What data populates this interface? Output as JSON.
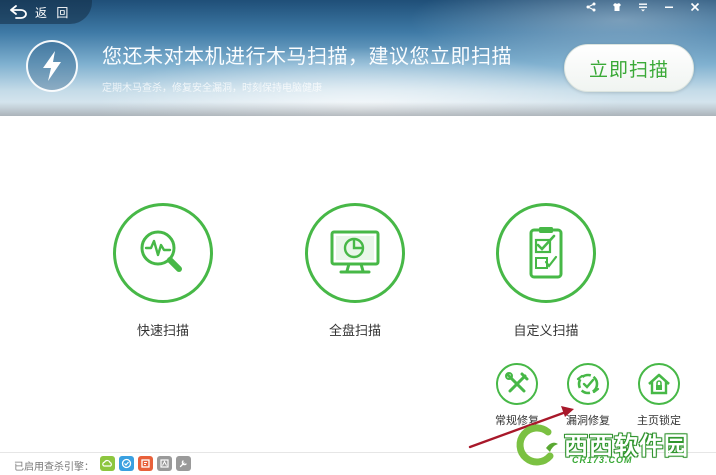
{
  "header": {
    "back_label": "返 回",
    "headline": "您还未对本机进行木马扫描，建议您立即扫描",
    "subline": "定期木马查杀，修复安全漏洞，时刻保持电脑健康",
    "scan_now_label": "立即扫描",
    "window_icons": [
      "share-icon",
      "skin-icon",
      "menu-icon",
      "minimize-icon",
      "close-icon"
    ]
  },
  "scan_options": [
    {
      "label": "快速扫描",
      "icon": "quick-scan-icon"
    },
    {
      "label": "全盘扫描",
      "icon": "full-scan-icon"
    },
    {
      "label": "自定义扫描",
      "icon": "custom-scan-icon"
    }
  ],
  "tools": [
    {
      "label": "常规修复",
      "icon": "wrench-screwdriver-icon"
    },
    {
      "label": "漏洞修复",
      "icon": "patch-icon"
    },
    {
      "label": "主页锁定",
      "icon": "home-lock-icon"
    }
  ],
  "footer": {
    "engines_label": "已启用查杀引擎：",
    "engines": [
      {
        "icon": "cloud-engine-icon",
        "color": "#8dc63f"
      },
      {
        "icon": "qvm-engine-icon",
        "color": "#3aa0e0"
      },
      {
        "icon": "bitdefender-engine-icon",
        "color": "#e8603a"
      },
      {
        "icon": "avira-engine-icon",
        "color": "#9a9a9a"
      },
      {
        "icon": "system-repair-engine-icon",
        "color": "#9a9a9a"
      }
    ]
  },
  "watermark": {
    "brand": "西西软件园",
    "domain": "CR173.COM"
  },
  "colors": {
    "accent_green": "#47b847",
    "annotation_arrow": "#a8182a"
  }
}
